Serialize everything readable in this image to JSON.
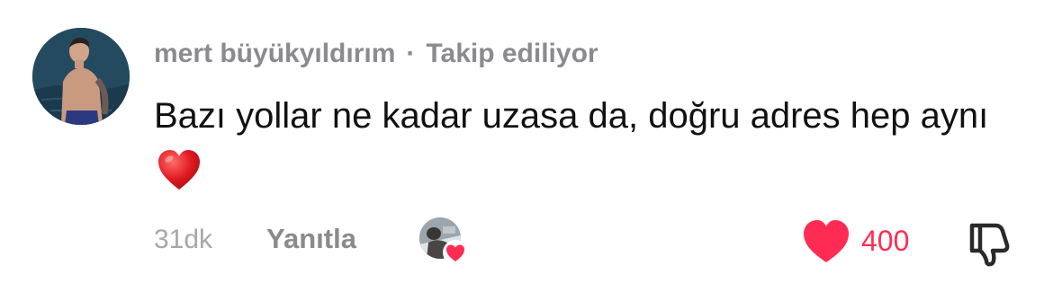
{
  "comment": {
    "author": "mert büyükyıldırım",
    "separator": "·",
    "relation": "Takip ediliyor",
    "text": "Bazı yollar ne kadar uzasa da, doğru adres hep aynı",
    "emoji": "heart-emoji",
    "timestamp": "31dk",
    "reply_label": "Yanıtla",
    "like_count": "400",
    "creator_liked": true
  },
  "icons": {
    "like": "heart-icon",
    "dislike": "thumbs-down-icon",
    "creator_like_badge": "heart-icon"
  },
  "colors": {
    "like": "#fe2c55",
    "secondary_text": "#8a8a8f",
    "timestamp": "#a6a6ab",
    "body_text": "#111111"
  }
}
